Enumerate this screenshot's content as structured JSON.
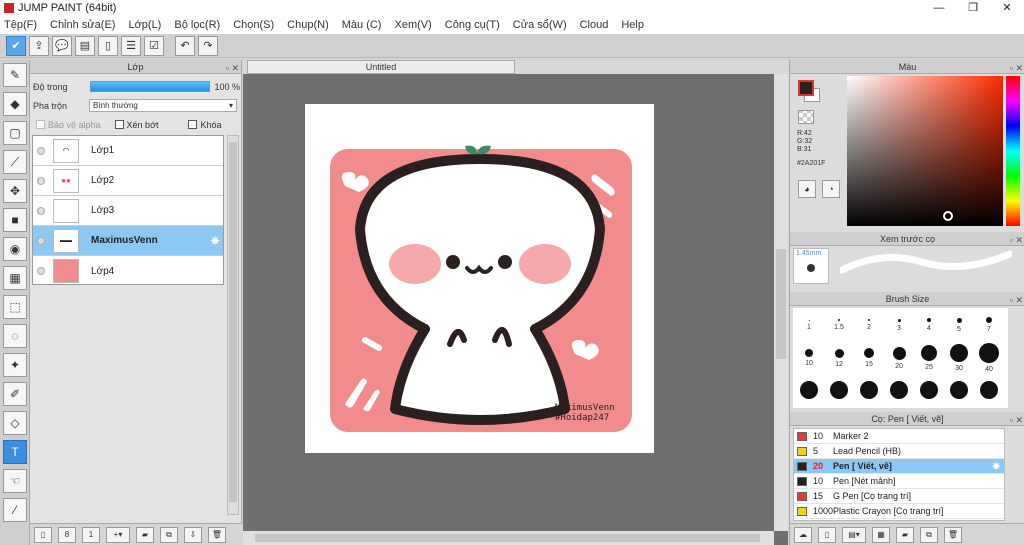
{
  "window": {
    "title": "JUMP PAINT (64bit)",
    "minimize": "—",
    "restore": "❐",
    "close": "✕"
  },
  "menu": [
    "Tệp(F)",
    "Chỉnh sửa(E)",
    "Lớp(L)",
    "Bộ lọc(R)",
    "Chọn(S)",
    "Chụp(N)",
    "Màu (C)",
    "Xem(V)",
    "Công cụ(T)",
    "Cửa sổ(W)",
    "Cloud",
    "Help"
  ],
  "layer_panel": {
    "title": "Lớp",
    "opacity_label": "Độ trong",
    "opacity_value": "100 %",
    "opacity_fraction": 1.0,
    "blend_label": "Pha trộn",
    "blend_value": "Bình thường",
    "protect_alpha": "Bảo vệ alpha",
    "clip": "Xén bớt",
    "lock": "Khóa",
    "layers": [
      {
        "name": "Lớp1",
        "selected": false
      },
      {
        "name": "Lớp2",
        "selected": false
      },
      {
        "name": "Lớp3",
        "selected": false
      },
      {
        "name": "MaximusVenn",
        "selected": true
      },
      {
        "name": "Lớp4",
        "selected": false
      }
    ]
  },
  "canvas": {
    "tab_title": "Untitled",
    "watermark_line1": "MaximusVenn",
    "watermark_line2": "#Hoidap247"
  },
  "color_panel": {
    "title": "Màu",
    "r": "R:42",
    "g": "G:32",
    "b": "B:31",
    "hex": "#2A201F",
    "current_color": "#2A201F"
  },
  "brush_preview": {
    "title": "Xem trước cọ",
    "size": "1.45mm"
  },
  "brush_size": {
    "title": "Brush Size",
    "rows": [
      [
        "1",
        "1.5",
        "2",
        "3",
        "4",
        "5",
        "7"
      ],
      [
        "10",
        "12",
        "15",
        "20",
        "25",
        "30",
        "40"
      ],
      [
        "",
        "",
        "",
        "",
        "",
        "",
        ""
      ]
    ]
  },
  "brush_list": {
    "title": "Cọ: Pen [ Viết, vẽ]",
    "items": [
      {
        "size": "10",
        "name": "Marker 2",
        "color": "#e83a3a",
        "selected": false
      },
      {
        "size": "5",
        "name": "Lead Pencil (HB)",
        "color": "#f0d020",
        "selected": false
      },
      {
        "size": "20",
        "name": "Pen [ Viết, vẽ]",
        "color": "#222222",
        "selected": true
      },
      {
        "size": "10",
        "name": "Pen [Nét mảnh]",
        "color": "#222222",
        "selected": false
      },
      {
        "size": "15",
        "name": "G Pen [Cọ trang trí]",
        "color": "#e83a3a",
        "selected": false
      },
      {
        "size": "1000",
        "name": "Plastic Crayon [Cọ trang trí]",
        "color": "#f0d020",
        "selected": false
      }
    ]
  }
}
